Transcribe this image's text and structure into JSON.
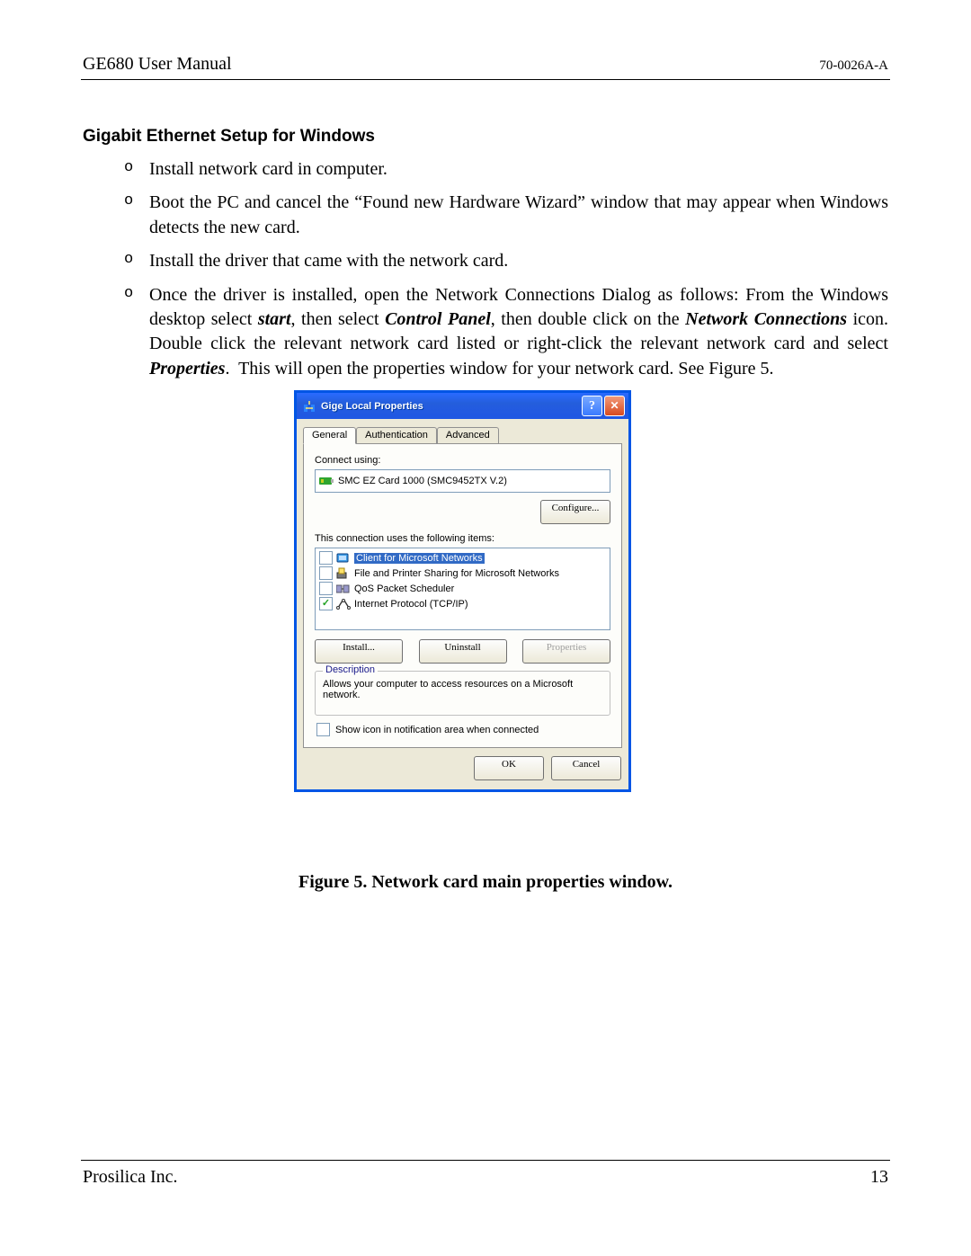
{
  "header": {
    "left": "GE680 User Manual",
    "right": "70-0026A-A"
  },
  "section_title": "Gigabit Ethernet Setup for Windows",
  "bullets": [
    "Install network card in computer.",
    "Boot the PC and cancel the “Found new Hardware Wizard” window that may appear when Windows detects the new card.",
    "Install the driver that came with the network card.",
    "Once the driver is installed, open the Network Connections Dialog as follows: From the Windows desktop select <i><b>start</b></i>, then select <i><b>Control Panel</b></i>, then double click on the <i><b>Network Connections</b></i> icon. Double click the relevant network card listed or right-click the relevant network card and select <i><b>Properties</b></i>.&nbsp;  This will open the properties window for your network card. See Figure 5."
  ],
  "dialog": {
    "title": "Gige Local Properties",
    "tabs": [
      "General",
      "Authentication",
      "Advanced"
    ],
    "connect_label": "Connect using:",
    "connect_value": "SMC EZ Card 1000 (SMC9452TX V.2)",
    "configure": "Configure...",
    "items_label": "This connection uses the following items:",
    "items": [
      {
        "checked": false,
        "label": "Client for Microsoft Networks",
        "sel": true
      },
      {
        "checked": false,
        "label": "File and Printer Sharing for Microsoft Networks",
        "sel": false
      },
      {
        "checked": false,
        "label": "QoS Packet Scheduler",
        "sel": false
      },
      {
        "checked": true,
        "label": "Internet Protocol (TCP/IP)",
        "sel": false
      }
    ],
    "install": "Install...",
    "uninstall": "Uninstall",
    "properties": "Properties",
    "desc_legend": "Description",
    "desc_text": "Allows your computer to access resources on a Microsoft network.",
    "show_icon": "Show icon in notification area when connected",
    "ok": "OK",
    "cancel": "Cancel"
  },
  "figure_caption": "Figure 5.  Network card main properties window.",
  "footer": {
    "left": "Prosilica Inc.",
    "right": "13"
  }
}
